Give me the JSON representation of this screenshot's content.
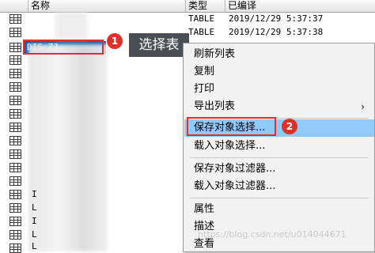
{
  "header": {
    "name_col": "名称",
    "type_col": "类型",
    "date_col": "已编译"
  },
  "rows": [
    {
      "name": "",
      "type": "TABLE",
      "date": "2019/12/29 5:37:37"
    },
    {
      "name": "",
      "type": "TABLE",
      "date": "2019/12/29 5:37:38"
    },
    {
      "name": "DIS ZJ",
      "type": "",
      "date": ""
    }
  ],
  "left_letters": [
    "I",
    "L",
    "I",
    "L",
    "L"
  ],
  "annotations": {
    "step1": "1",
    "step2": "2",
    "tag": "选择表"
  },
  "menu": {
    "items": [
      {
        "label": "刷新列表"
      },
      {
        "label": "复制"
      },
      {
        "label": "打印"
      },
      {
        "label": "导出列表",
        "arrow": "›"
      },
      {
        "label": "保存对象选择..."
      },
      {
        "label": "载入对象选择..."
      },
      {
        "label": "保存对象过滤器..."
      },
      {
        "label": "载入对象过滤器..."
      },
      {
        "label": "属性"
      },
      {
        "label": "描述"
      },
      {
        "label": "查看"
      }
    ]
  },
  "watermark": "https://blog.csdn.net/u014044671",
  "colors": {
    "selection": "#0b61b4",
    "menu_highlight": "#91c9f7",
    "annotation_red": "#e0302a"
  }
}
